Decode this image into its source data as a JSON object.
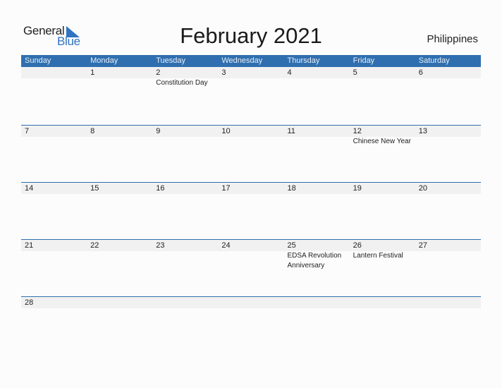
{
  "logo": {
    "line1": "General",
    "line2": "Blue",
    "brand_color": "#2f74c0",
    "icon": "logo-triangle-icon"
  },
  "title": "February 2021",
  "country": "Philippines",
  "colors": {
    "header_bg": "#2f6faf",
    "daybar_bg": "#f1f1f1",
    "separator": "#2f6faf"
  },
  "weekdays": [
    "Sunday",
    "Monday",
    "Tuesday",
    "Wednesday",
    "Thursday",
    "Friday",
    "Saturday"
  ],
  "weeks": [
    {
      "days": [
        "",
        "1",
        "2",
        "3",
        "4",
        "5",
        "6"
      ],
      "events": [
        "",
        "",
        "Constitution Day",
        "",
        "",
        "",
        ""
      ]
    },
    {
      "days": [
        "7",
        "8",
        "9",
        "10",
        "11",
        "12",
        "13"
      ],
      "events": [
        "",
        "",
        "",
        "",
        "",
        "Chinese New Year",
        ""
      ]
    },
    {
      "days": [
        "14",
        "15",
        "16",
        "17",
        "18",
        "19",
        "20"
      ],
      "events": [
        "",
        "",
        "",
        "",
        "",
        "",
        ""
      ]
    },
    {
      "days": [
        "21",
        "22",
        "23",
        "24",
        "25",
        "26",
        "27"
      ],
      "events": [
        "",
        "",
        "",
        "",
        "EDSA Revolution Anniversary",
        "Lantern Festival",
        ""
      ]
    },
    {
      "days": [
        "28",
        "",
        "",
        "",
        "",
        "",
        ""
      ],
      "events": [
        "",
        "",
        "",
        "",
        "",
        "",
        ""
      ]
    }
  ]
}
